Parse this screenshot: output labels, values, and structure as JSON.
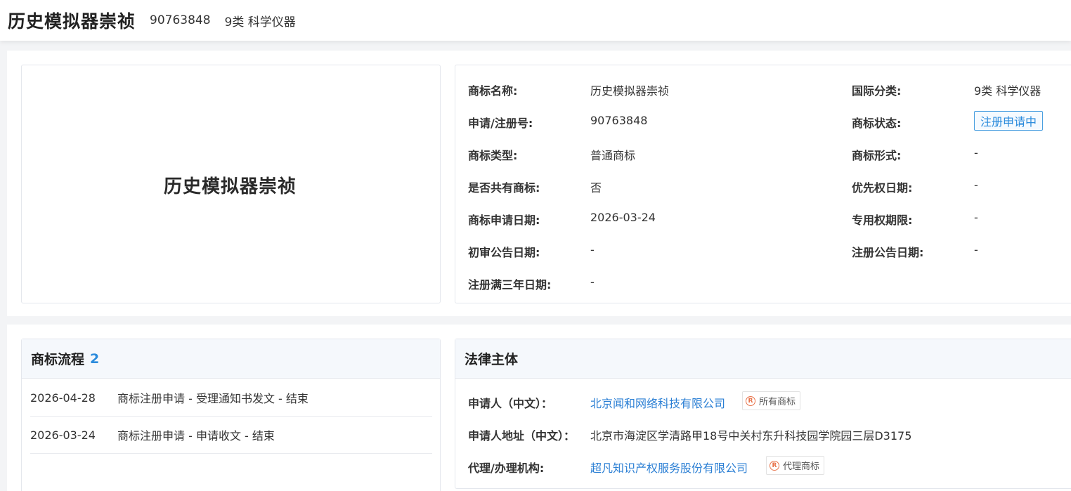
{
  "header": {
    "title": "历史模拟器崇祯",
    "reg_no": "90763848",
    "class": "9类 科学仪器"
  },
  "logo": {
    "text": "历史模拟器崇祯"
  },
  "info": {
    "name_label": "商标名称:",
    "name_value": "历史模拟器崇祯",
    "intl_class_label": "国际分类:",
    "intl_class_value": "9类 科学仪器",
    "reg_no_label": "申请/注册号:",
    "reg_no_value": "90763848",
    "status_label": "商标状态:",
    "status_value": "注册申请中",
    "type_label": "商标类型:",
    "type_value": "普通商标",
    "form_label": "商标形式:",
    "form_value": "-",
    "shared_label": "是否共有商标:",
    "shared_value": "否",
    "priority_label": "优先权日期:",
    "priority_value": "-",
    "apply_date_label": "商标申请日期:",
    "apply_date_value": "2026-03-24",
    "exclusive_label": "专用权期限:",
    "exclusive_value": "-",
    "prelim_label": "初审公告日期:",
    "prelim_value": "-",
    "reg_notice_label": "注册公告日期:",
    "reg_notice_value": "-",
    "three_year_label": "注册满三年日期:",
    "three_year_value": "-"
  },
  "flow": {
    "title": "商标流程",
    "count": "2",
    "items": [
      {
        "date": "2026-04-28",
        "desc": "商标注册申请 - 受理通知书发文 - 结束"
      },
      {
        "date": "2026-03-24",
        "desc": "商标注册申请 - 申请收文 - 结束"
      }
    ]
  },
  "legal": {
    "title": "法律主体",
    "applicant_label": "申请人（中文）：",
    "applicant_value": "北京闻和网络科技有限公司",
    "applicant_badge": "所有商标",
    "address_label": "申请人地址（中文）：",
    "address_value": "北京市海淀区学清路甲18号中关村东升科技园学院园三层D3175",
    "agent_label": "代理/办理机构:",
    "agent_value": "超凡知识产权服务股份有限公司",
    "agent_badge": "代理商标",
    "badge_icon": "registered-icon"
  },
  "colors": {
    "accent": "#2b8bdc",
    "badge_icon": "#e8734a"
  }
}
